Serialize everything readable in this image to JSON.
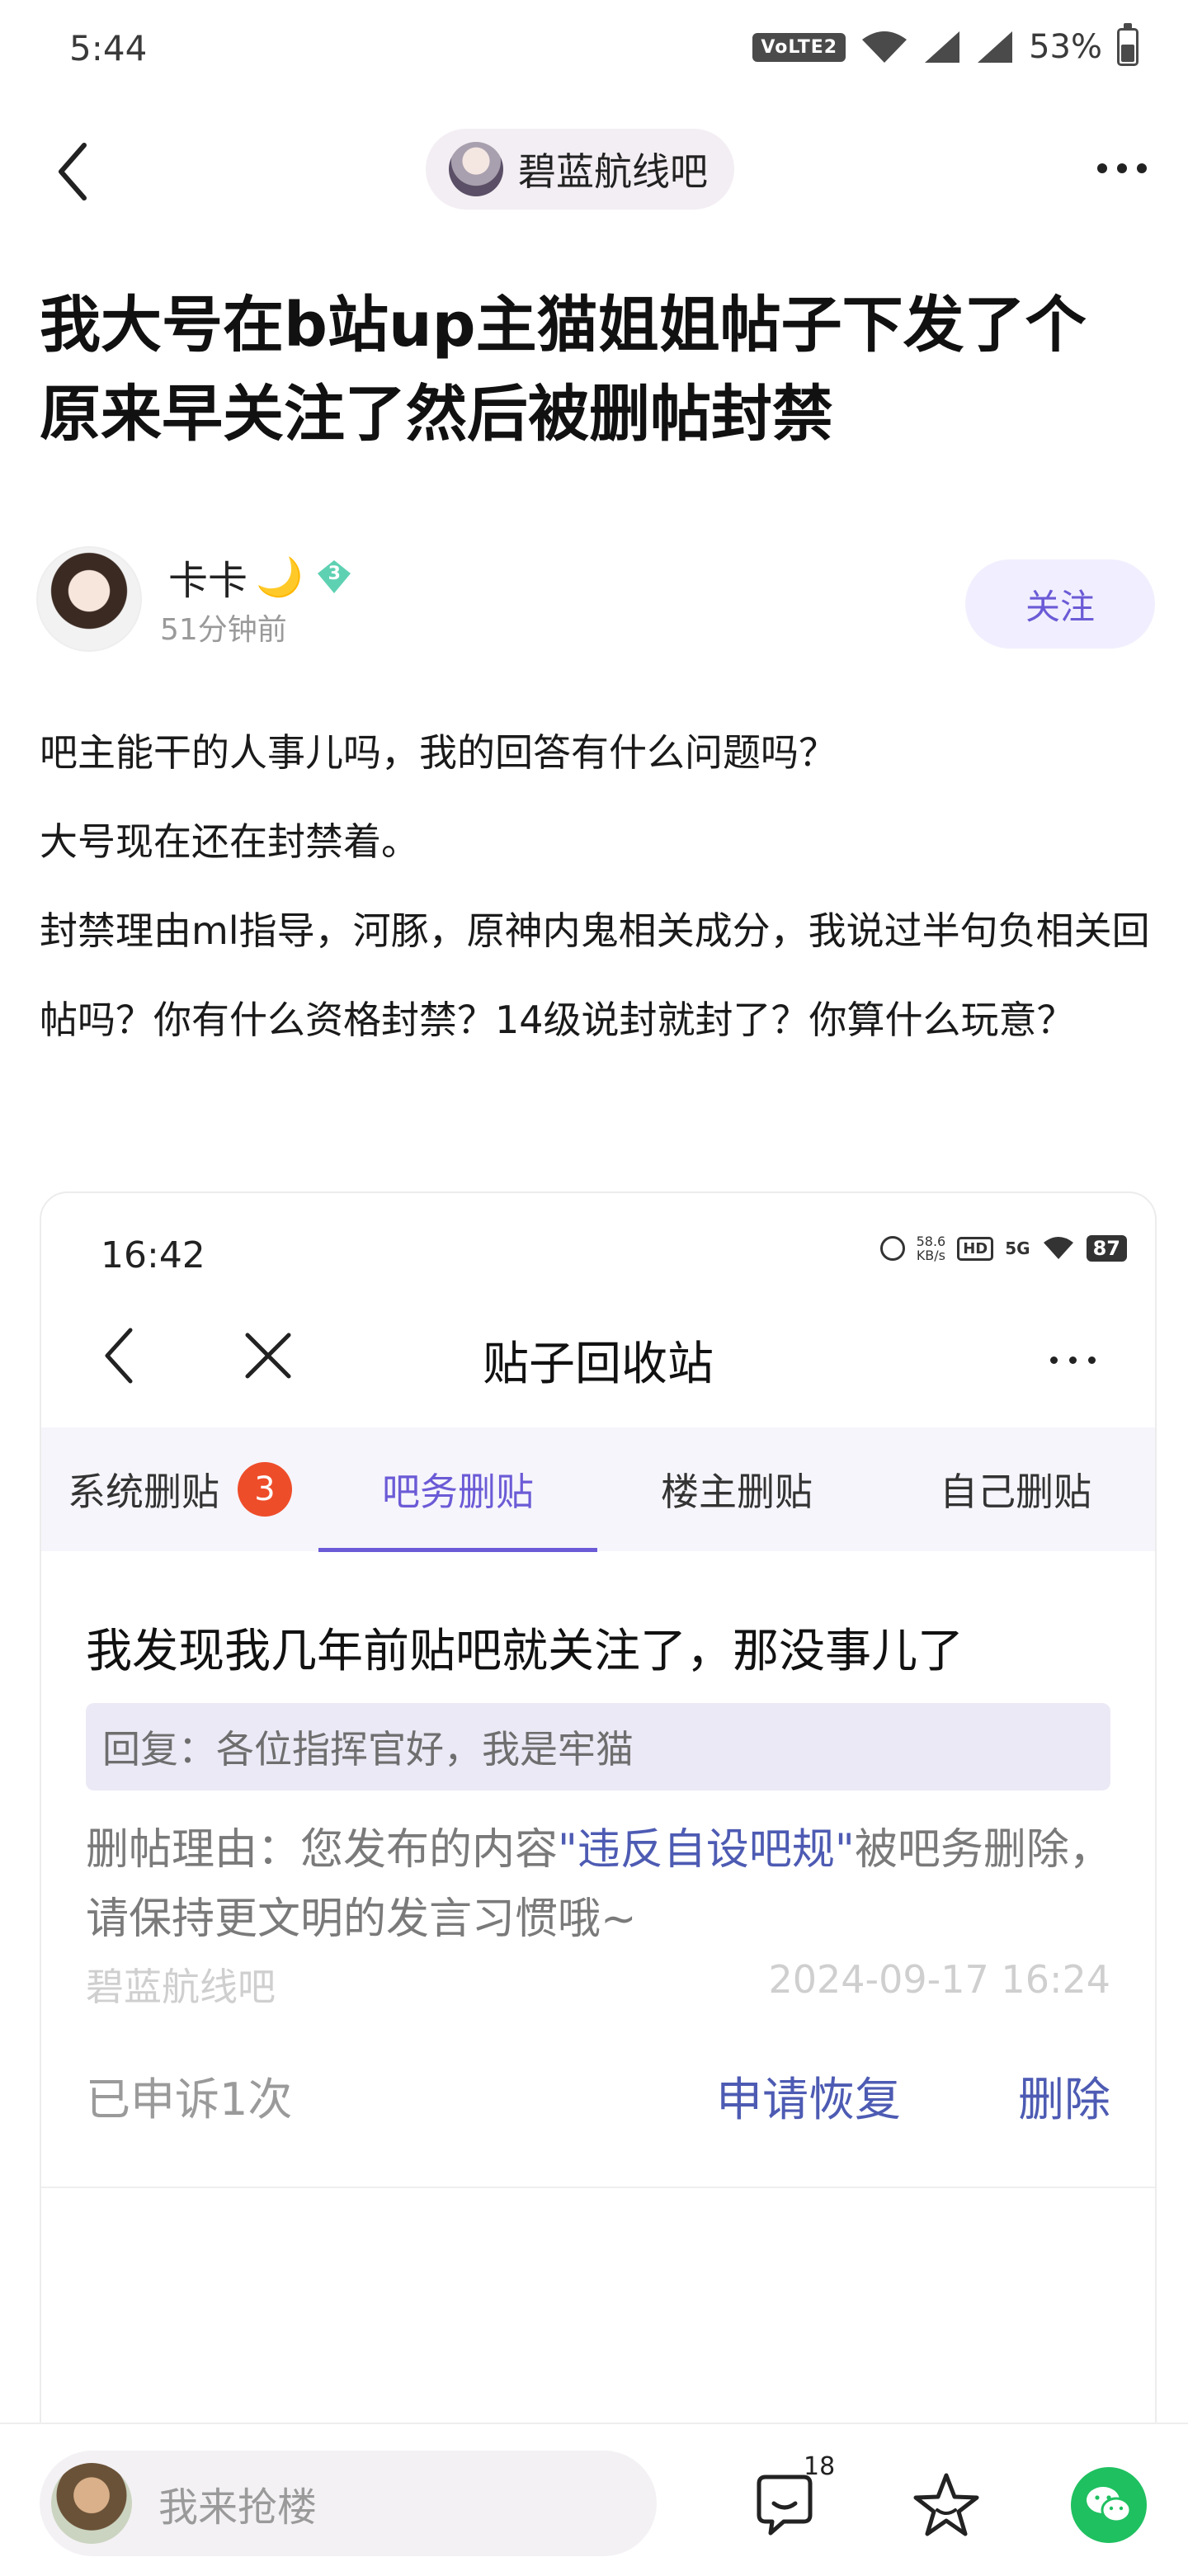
{
  "status_bar": {
    "time": "5:44",
    "network": "VoLTE2",
    "battery_percent": "53%",
    "battery_level": 0.53
  },
  "header": {
    "forum_name": "碧蓝航线吧"
  },
  "post": {
    "title": "我大号在b站up主猫姐姐帖子下发了个原来早关注了然后被删帖封禁",
    "author": {
      "name": "卡卡",
      "level": "3",
      "time": "51分钟前"
    },
    "follow_label": "关注",
    "paragraphs": [
      "吧主能干的人事儿吗，我的回答有什么问题吗？",
      "大号现在还在封禁着。",
      "封禁理由ml指导，河豚，原神内鬼相关成分，我说过半句负相关回帖吗？你有什么资格封禁？14级说封就封了？你算什么玩意？"
    ]
  },
  "screenshot": {
    "status": {
      "time": "16:42",
      "speed_value": "58.6",
      "speed_unit": "KB/s",
      "hd": "HD",
      "network": "5G",
      "battery": "87"
    },
    "page_title": "贴子回收站",
    "tabs": [
      {
        "label": "系统删贴",
        "badge": "3"
      },
      {
        "label": "吧务删贴"
      },
      {
        "label": "楼主删贴"
      },
      {
        "label": "自己删贴"
      }
    ],
    "active_tab_index": 1,
    "item": {
      "title": "我发现我几年前贴吧就关注了，那没事儿了",
      "reply": "回复：各位指挥官好，我是牢猫",
      "reason_prefix": "删帖理由：您发布的内容",
      "reason_link": "\"违反自设吧规\"",
      "reason_suffix": "被吧务删除，请保持更文明的发言习惯哦~",
      "forum": "碧蓝航线吧",
      "datetime": "2024-09-17 16:24",
      "appeal_status": "已申诉1次",
      "restore_label": "申请恢复",
      "delete_label": "删除"
    }
  },
  "bottom_bar": {
    "reply_placeholder": "我来抢楼",
    "comment_count": "18"
  },
  "colors": {
    "accent": "#6b5bd6",
    "link": "#4d5bb3",
    "badge": "#ee4d2a",
    "wechat": "#1fc060"
  }
}
